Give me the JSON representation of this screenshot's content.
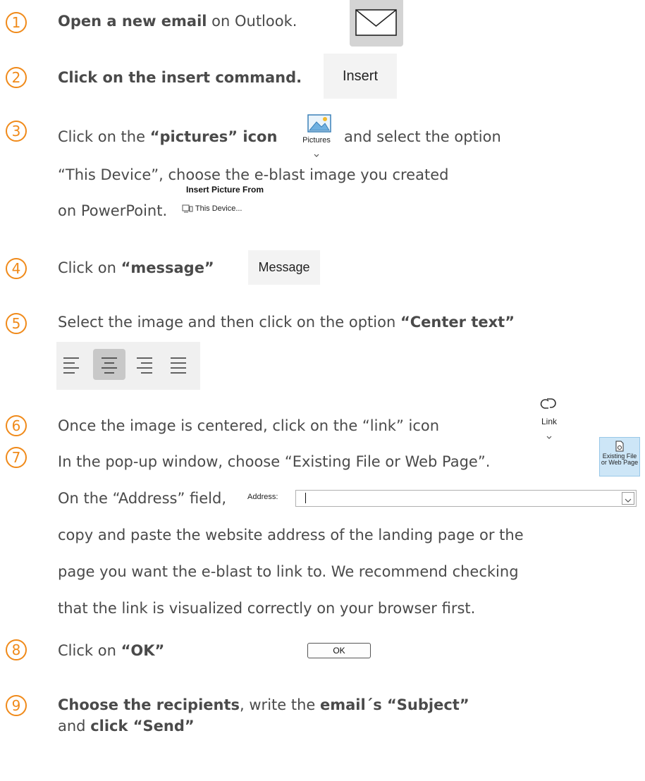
{
  "steps": [
    {
      "num": "1",
      "bold": "Open a new email",
      "rest": " on Outlook."
    },
    {
      "num": "2",
      "bold": "Click on the insert command."
    },
    {
      "num": "3",
      "pre": "Click on the ",
      "bold": "“pictures” icon",
      "post": "and select the option",
      "line2": "“This Device”, choose the e-blast image you created",
      "line3": "on PowerPoint."
    },
    {
      "num": "4",
      "pre": "Click on ",
      "bold": "“message”"
    },
    {
      "num": "5",
      "pre": "Select the image and then click on the option ",
      "bold": "“Center text”"
    },
    {
      "num": "6",
      "text": "Once the image is centered, click on the “link” icon"
    },
    {
      "num": "7",
      "text": "In the pop-up window, choose “Existing File or Web Page”.",
      "line2": "On the “Address” field,",
      "line3": "copy and paste the website address of the landing page or the",
      "line4": "page you want the e-blast to link to. We recommend checking",
      "line5": "that the link is visualized correctly on your browser first."
    },
    {
      "num": "8",
      "pre": "Click on ",
      "bold": "“OK”"
    },
    {
      "num": "9",
      "bold1": "Choose the recipients",
      "mid1": ", write the ",
      "bold2": "email´s “Subject”",
      "line2_bold_pre": " and ",
      "line2_bold": "click “Send”"
    }
  ],
  "ui": {
    "insert_label": "Insert",
    "pictures_label": "Pictures",
    "insert_picture_from": "Insert Picture From",
    "this_device": "This Device...",
    "message_label": "Message",
    "link_label": "Link",
    "existing_line1": "Existing File",
    "existing_line2": "or Web Page",
    "address_label": "Address:",
    "ok_label": "OK"
  },
  "colors": {
    "accent": "#f08a1a",
    "text": "#4a4a4a"
  }
}
